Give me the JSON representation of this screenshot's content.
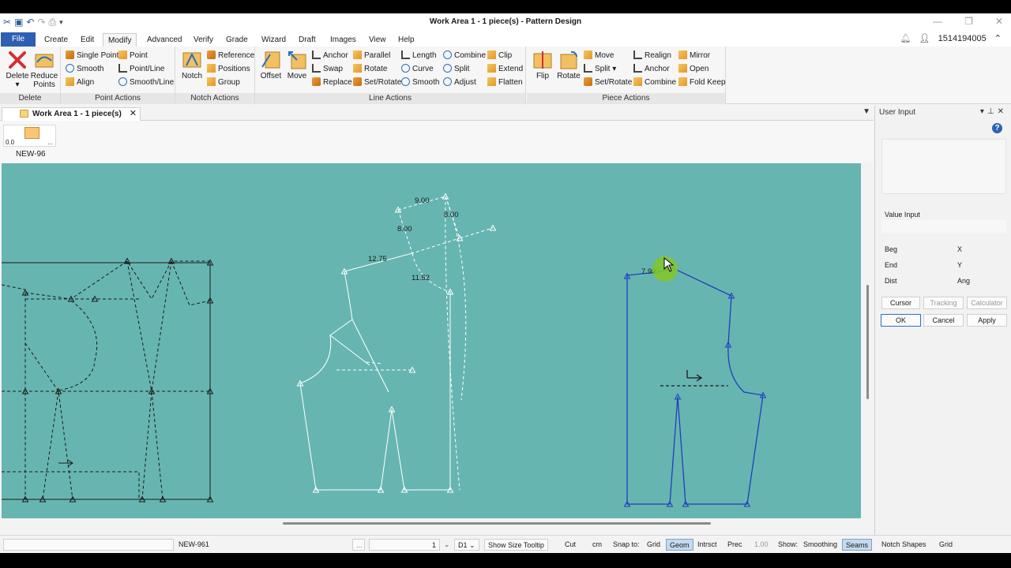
{
  "window": {
    "title": "Work Area 1  -  1 piece(s) - Pattern Design"
  },
  "menu": {
    "tabs": [
      "File",
      "Create",
      "Edit",
      "Modify",
      "Advanced",
      "Verify",
      "Grade",
      "Wizard",
      "Draft",
      "Images",
      "View",
      "Help"
    ],
    "active": "Modify",
    "user_id": "1514194005"
  },
  "ribbon": {
    "delete_group": {
      "label": "Delete",
      "delete": "Delete",
      "reduce": "Reduce Points"
    },
    "point_group": {
      "label": "Point Actions",
      "items": [
        "Single Point",
        "Point",
        "Smooth",
        "Point/Line",
        "Align",
        "Smooth/Line"
      ]
    },
    "notch_group": {
      "label": "Notch Actions",
      "notch": "Notch",
      "items": [
        "Reference",
        "Positions",
        "Group"
      ]
    },
    "line_group": {
      "label": "Line Actions",
      "offset": "Offset",
      "move": "Move",
      "items": [
        "Anchor",
        "Parallel",
        "Length",
        "Combine",
        "Clip",
        "Swap",
        "Rotate",
        "Curve",
        "Split",
        "Extend",
        "Replace",
        "Set/Rotate",
        "Smooth",
        "Adjust",
        "Flatten"
      ]
    },
    "piece_group": {
      "label": "Piece Actions",
      "flip": "Flip",
      "rotate": "Rotate",
      "items": [
        "Move",
        "Realign",
        "Mirror",
        "Split",
        "Anchor",
        "Open",
        "Set/Rotate",
        "Combine",
        "Fold Keep"
      ]
    }
  },
  "document": {
    "tab_label": "Work Area 1  -  1 piece(s)",
    "piece_zero": "0.0",
    "piece_dots": "...",
    "piece_name": "NEW-96"
  },
  "canvas": {
    "labels": [
      "9.00",
      "8.00",
      "8.00",
      "12.75",
      "11.52",
      "7.99"
    ],
    "colors": {
      "background": "#67b5b0",
      "selected": "#1f3fbf",
      "active": "#ffffff",
      "inactive": "#1a1a1a"
    }
  },
  "panel": {
    "title": "User Input",
    "value_input": "Value Input",
    "rows": [
      {
        "l": "Beg",
        "r": "X"
      },
      {
        "l": "End",
        "r": "Y"
      },
      {
        "l": "Dist",
        "r": "Ang"
      }
    ],
    "mode_buttons": [
      "Cursor",
      "Tracking",
      "Calculator"
    ],
    "ok": "OK",
    "cancel": "Cancel",
    "apply": "Apply"
  },
  "status": {
    "piece": "NEW-961",
    "ellipsis": "...",
    "size_value": "1",
    "size_name": "D1",
    "show_size_tooltip": "Show Size Tooltip",
    "cut": "Cut",
    "units": "cm",
    "snap_label": "Snap to:",
    "snap": [
      "Grid",
      "Geom",
      "Intrsct",
      "Prec"
    ],
    "precision": "1.00",
    "show_label": "Show:",
    "show": [
      "Smoothing",
      "Seams",
      "Notch Shapes",
      "Grid"
    ]
  }
}
